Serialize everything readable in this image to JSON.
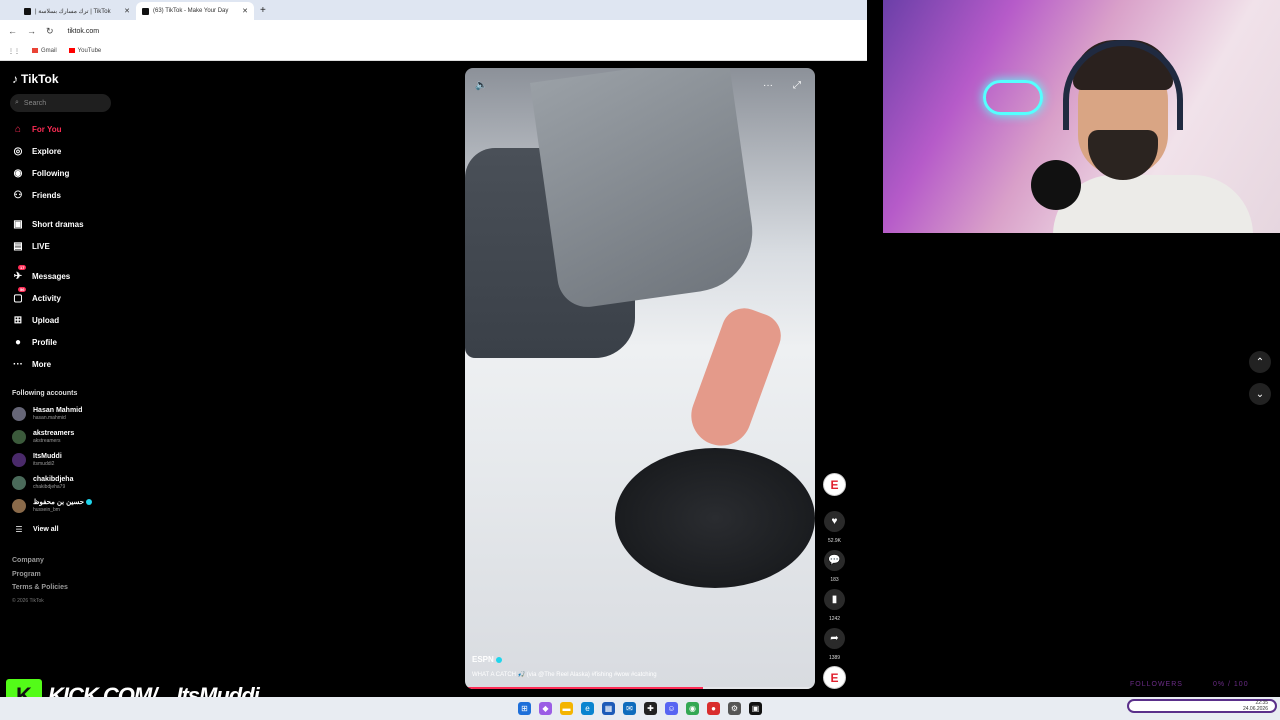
{
  "browser": {
    "tabs": [
      {
        "label": "| ترك مسارك بسلاسة | TikTok"
      },
      {
        "label": "(63) TikTok - Make Your Day"
      }
    ],
    "new_tab": "+",
    "url": "tiktok.com",
    "bookmarks": [
      {
        "label": "Gmail"
      },
      {
        "label": "YouTube"
      }
    ]
  },
  "tiktok": {
    "logo": "TikTok",
    "search_placeholder": "Search",
    "menu": [
      {
        "label": "For You",
        "icon": "home-icon",
        "active": true
      },
      {
        "label": "Explore",
        "icon": "compass-icon"
      },
      {
        "label": "Following",
        "icon": "following-icon"
      },
      {
        "label": "Friends",
        "icon": "friends-icon"
      },
      {
        "label": "Short dramas",
        "icon": "drama-icon"
      },
      {
        "label": "LIVE",
        "icon": "live-icon"
      },
      {
        "label": "Messages",
        "icon": "message-icon",
        "badge": "17"
      },
      {
        "label": "Activity",
        "icon": "activity-icon",
        "badge": "56"
      },
      {
        "label": "Upload",
        "icon": "upload-icon"
      },
      {
        "label": "Profile",
        "icon": "profile-icon"
      },
      {
        "label": "More",
        "icon": "more-icon"
      }
    ],
    "following_title": "Following accounts",
    "accounts": [
      {
        "name": "Hasan Mahmid",
        "handle": "hasan.mahmid"
      },
      {
        "name": "akstreamers",
        "handle": "akstreamers"
      },
      {
        "name": "ItsMuddi",
        "handle": "itsmuddi2"
      },
      {
        "name": "chakibdjeha",
        "handle": "chakibdjeha79"
      },
      {
        "name": "حسين بن محفوظ",
        "handle": "hussein_bm",
        "verified": true
      }
    ],
    "view_all": "View all",
    "footer": [
      "Company",
      "Program",
      "Terms & Policies"
    ],
    "copyright": "© 2026 TikTok"
  },
  "video": {
    "author": "ESPN",
    "caption": "WHAT A CATCH 🎣 (via @The Reel Alaska) #fishing #wow #catching",
    "progress": 0.68,
    "likes": "52.9K",
    "comments": "183",
    "saves": "1242",
    "shares": "1389"
  },
  "overlay": {
    "kick_logo": "K",
    "kick_url": "KICK.COM/",
    "kick_user": "ItsMuddi",
    "followers_label": "FOLLOWERS",
    "followers_value": "0% / 100"
  },
  "taskbar": {
    "time": "22:35",
    "date": "24.06.2026"
  }
}
